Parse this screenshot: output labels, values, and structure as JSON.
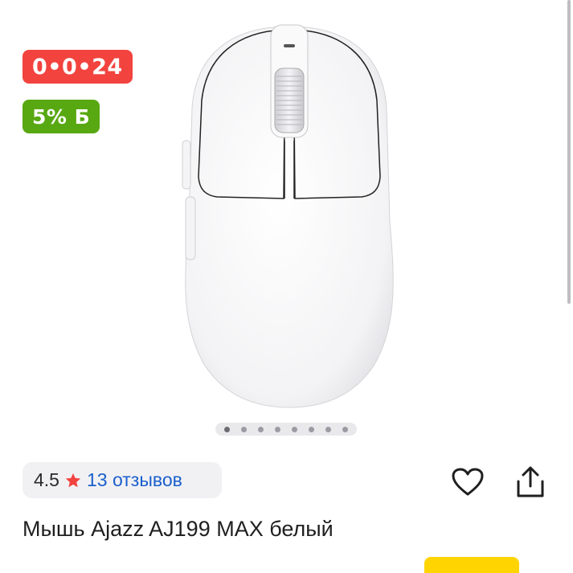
{
  "badges": {
    "timer": "0•0•24",
    "cashback": "5% Б"
  },
  "gallery": {
    "image_alt": "white gaming mouse",
    "slide_count": 8,
    "active_index": 0
  },
  "rating": {
    "value": "4.5",
    "reviews_label": "13 отзывов",
    "star_color": "#f2433f"
  },
  "actions": {
    "favorite_icon": "heart-icon",
    "share_icon": "share-icon"
  },
  "product": {
    "title": "Мышь Ajazz AJ199 MAX белый"
  },
  "colors": {
    "timer_badge": "#f2433f",
    "cashback_badge": "#58a812",
    "link": "#1a5fcc"
  }
}
